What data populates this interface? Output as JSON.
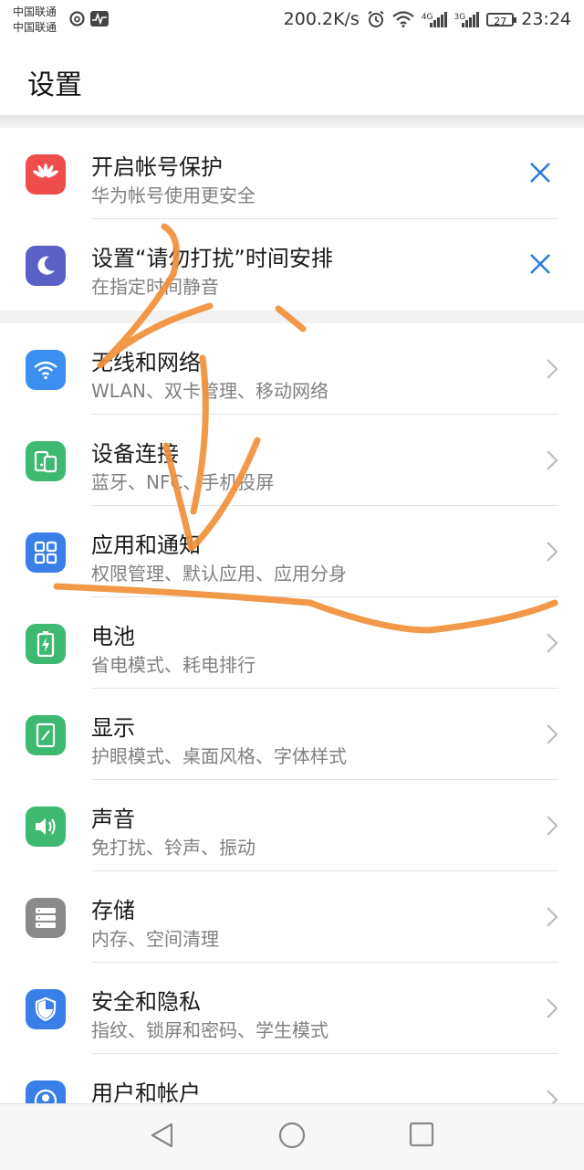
{
  "status_bar": {
    "carrier_1": "中国联通",
    "carrier_2": "中国联通",
    "speed": "200.2K/s",
    "sig1_label": "4G",
    "sig2_label": "3G",
    "battery": "27",
    "time": "23:24"
  },
  "header": {
    "title": "设置"
  },
  "suggestions": [
    {
      "title": "开启帐号保护",
      "subtitle": "华为帐号使用更安全",
      "icon": "huawei-logo-icon",
      "color": "#ef4c4c"
    },
    {
      "title": "设置“请勿打扰”时间安排",
      "subtitle": "在指定时间静音",
      "icon": "moon-icon",
      "color": "#5b5fc7"
    }
  ],
  "settings": [
    {
      "title": "无线和网络",
      "subtitle": "WLAN、双卡管理、移动网络",
      "icon": "wifi-icon",
      "color": "#3a8ff0"
    },
    {
      "title": "设备连接",
      "subtitle": "蓝牙、NFC、手机投屏",
      "icon": "device-connection-icon",
      "color": "#3dba6f"
    },
    {
      "title": "应用和通知",
      "subtitle": "权限管理、默认应用、应用分身",
      "icon": "apps-grid-icon",
      "color": "#3a7ee8"
    },
    {
      "title": "电池",
      "subtitle": "省电模式、耗电排行",
      "icon": "battery-icon",
      "color": "#3dba6f"
    },
    {
      "title": "显示",
      "subtitle": "护眼模式、桌面风格、字体样式",
      "icon": "display-icon",
      "color": "#3dba6f"
    },
    {
      "title": "声音",
      "subtitle": "免打扰、铃声、振动",
      "icon": "speaker-icon",
      "color": "#3dba6f"
    },
    {
      "title": "存储",
      "subtitle": "内存、空间清理",
      "icon": "storage-icon",
      "color": "#8a8a8a"
    },
    {
      "title": "安全和隐私",
      "subtitle": "指纹、锁屏和密码、学生模式",
      "icon": "shield-icon",
      "color": "#3a7ee8"
    },
    {
      "title": "用户和帐户",
      "subtitle": "",
      "icon": "user-icon",
      "color": "#3a7ee8"
    }
  ],
  "accent_color": "#2d7bd8",
  "annotation_color": "#f0903a"
}
